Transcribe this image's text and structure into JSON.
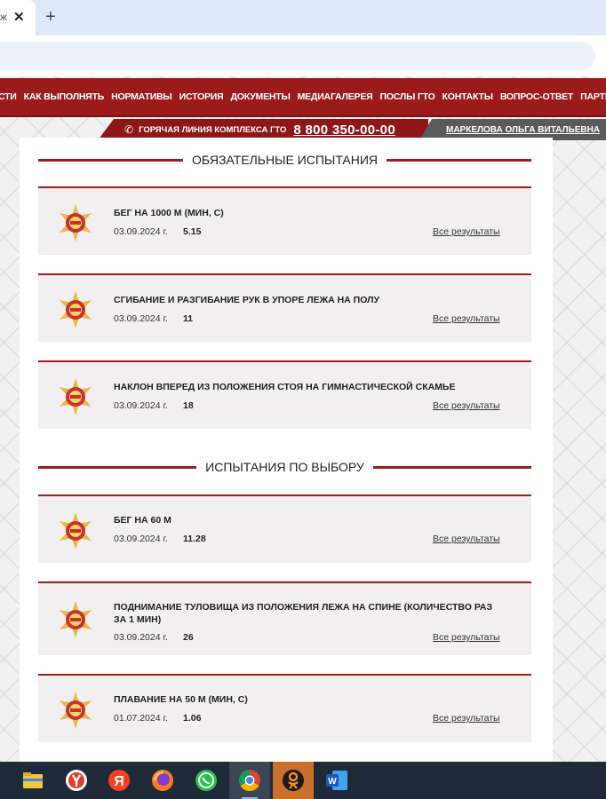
{
  "browser": {
    "tab_partial": "ж",
    "close_glyph": "✕",
    "new_tab_glyph": "+"
  },
  "nav": {
    "items": [
      "ОСТИ",
      "КАК ВЫПОЛНЯТЬ",
      "НОРМАТИВЫ",
      "ИСТОРИЯ",
      "ДОКУМЕНТЫ",
      "МЕДИАГАЛЕРЕЯ",
      "ПОСЛЫ ГТО",
      "КОНТАКТЫ",
      "ВОПРОС-ОТВЕТ",
      "ПАРТНЕРЫ"
    ]
  },
  "hotline": {
    "label": "ГОРЯЧАЯ ЛИНИЯ КОМПЛЕКСА ГТО",
    "number": "8 800 350-00-00",
    "icon": "phone-icon"
  },
  "user": {
    "name": "МАРКЕЛОВА ОЛЬГА ВИТАЛЬЕВНА"
  },
  "mandatory": {
    "title": "ОБЯЗАТЕЛЬНЫЕ ИСПЫТАНИЯ",
    "tests": [
      {
        "name": "БЕГ НА 1000 М (МИН, С)",
        "date": "03.09.2024 г.",
        "value": "5.15",
        "link": "Все результаты"
      },
      {
        "name": "СГИБАНИЕ И РАЗГИБАНИЕ РУК В УПОРЕ ЛЕЖА НА ПОЛУ",
        "date": "03.09.2024 г.",
        "value": "11",
        "link": "Все результаты"
      },
      {
        "name": "НАКЛОН ВПЕРЕД ИЗ ПОЛОЖЕНИЯ СТОЯ НА ГИМНАСТИЧЕСКОЙ СКАМЬЕ",
        "date": "03.09.2024 г.",
        "value": "18",
        "link": "Все результаты"
      }
    ]
  },
  "optional": {
    "title": "ИСПЫТАНИЯ ПО ВЫБОРУ",
    "tests": [
      {
        "name": "БЕГ НА 60 М",
        "date": "03.09.2024 г.",
        "value": "11.28",
        "link": "Все результаты"
      },
      {
        "name": "ПОДНИМАНИЕ ТУЛОВИЩА ИЗ ПОЛОЖЕНИЯ ЛЕЖА НА СПИНЕ (КОЛИЧЕСТВО РАЗ ЗА 1 МИН)",
        "date": "03.09.2024 г.",
        "value": "26",
        "link": "Все результаты"
      },
      {
        "name": "ПЛАВАНИЕ НА 50 М (МИН, С)",
        "date": "01.07.2024 г.",
        "value": "1.06",
        "link": "Все результаты"
      }
    ]
  },
  "taskbar": {
    "apps": [
      "file-explorer-icon",
      "yandex-browser-icon",
      "yandex-icon",
      "firefox-icon",
      "whatsapp-icon",
      "chrome-icon",
      "odnoklassniki-icon",
      "word-icon"
    ]
  },
  "colors": {
    "brand_red": "#9b1b1b",
    "accent_red": "#a01c1c",
    "gray_bar": "#5a5a5a",
    "card_bg": "#f1efef"
  }
}
